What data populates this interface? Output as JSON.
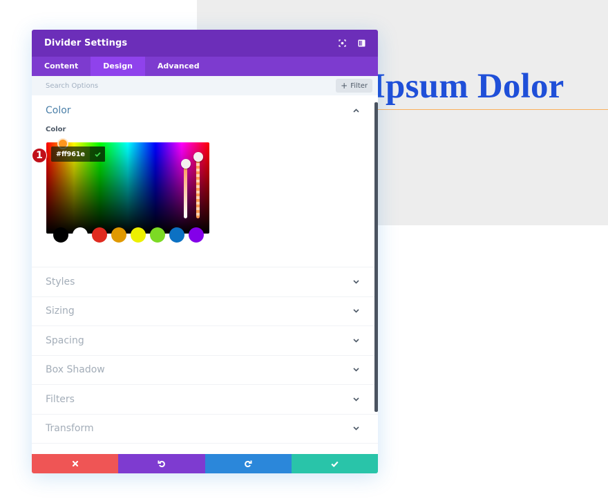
{
  "preview": {
    "heading_visible": "Ipsum Dolor",
    "heading_color": "#1f4fd8",
    "divider_color": "#ff961e"
  },
  "panel": {
    "title": "Divider Settings",
    "header_icons": [
      "focus-icon",
      "sidebar-toggle-icon"
    ],
    "tabs": [
      {
        "label": "Content",
        "active": false
      },
      {
        "label": "Design",
        "active": true
      },
      {
        "label": "Advanced",
        "active": false
      }
    ],
    "search": {
      "placeholder": "Search Options",
      "value": ""
    },
    "filter_label": "Filter",
    "open_section": {
      "title": "Color",
      "field_label": "Color",
      "color_picker": {
        "hex_value": "#ff961e",
        "step_badge": "1",
        "swatches": [
          "#000000",
          "#ffffff",
          "#e02b20",
          "#e09900",
          "#edf000",
          "#7cda24",
          "#0c71c3",
          "#8300e9"
        ]
      }
    },
    "collapsed_sections": [
      {
        "title": "Styles"
      },
      {
        "title": "Sizing"
      },
      {
        "title": "Spacing"
      },
      {
        "title": "Box Shadow"
      },
      {
        "title": "Filters"
      },
      {
        "title": "Transform"
      }
    ],
    "footer_buttons": [
      {
        "name": "discard",
        "icon": "close-icon",
        "color": "#ef5555"
      },
      {
        "name": "undo",
        "icon": "undo-icon",
        "color": "#7e3bd0"
      },
      {
        "name": "redo",
        "icon": "redo-icon",
        "color": "#2b87da"
      },
      {
        "name": "save",
        "icon": "check-icon",
        "color": "#29c4a9"
      }
    ],
    "colors": {
      "header": "#6c2eb9",
      "tabs": "#7d3bcf",
      "active_tab": "#8f42ec"
    }
  }
}
